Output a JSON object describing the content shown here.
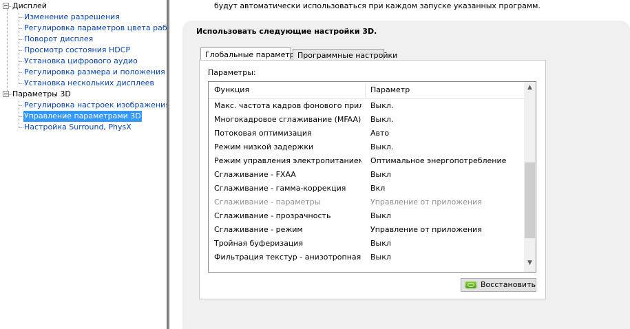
{
  "tree": {
    "display": {
      "label": "Дисплей",
      "items": [
        "Изменение разрешения",
        "Регулировка параметров цвета рабочег",
        "Поворот дисплея",
        "Просмотр состояния HDCP",
        "Установка цифрового аудио",
        "Регулировка размера и положения рабо",
        "Установка нескольких дисплеев"
      ]
    },
    "params3d": {
      "label": "Параметры 3D",
      "items": [
        "Регулировка настроек изображения с пр",
        "Управление параметрами 3D",
        "Настройка Surround, PhysX"
      ]
    }
  },
  "content": {
    "description_tail": "будут автоматически использоваться при каждом запуске указанных программ.",
    "section_title": "Использовать следующие настройки 3D.",
    "tabs": [
      "Глобальные параметры",
      "Программные настройки"
    ],
    "params_label": "Параметры:",
    "table": {
      "columns": [
        "Функция",
        "Параметр"
      ],
      "rows": [
        {
          "feature": "Макс. частота кадров фонового прило...",
          "value": "Выкл."
        },
        {
          "feature": "Многокадровое сглаживание (MFAA)",
          "value": "Выкл."
        },
        {
          "feature": "Потоковая оптимизация",
          "value": "Авто"
        },
        {
          "feature": "Режим низкой задержки",
          "value": "Выкл."
        },
        {
          "feature": "Режим управления электропитанием",
          "value": "Оптимальное энергопотребление"
        },
        {
          "feature": "Сглаживание - FXAA",
          "value": "Выкл"
        },
        {
          "feature": "Сглаживание - гамма-коррекция",
          "value": "Вкл"
        },
        {
          "feature": "Сглаживание - параметры",
          "value": "Управление от приложения"
        },
        {
          "feature": "Сглаживание - прозрачность",
          "value": "Выкл"
        },
        {
          "feature": "Сглаживание - режим",
          "value": "Управление от приложения"
        },
        {
          "feature": "Тройная буферизация",
          "value": "Выкл"
        },
        {
          "feature": "Фильтрация текстур - анизотропная оп...",
          "value": "Выкл"
        }
      ]
    },
    "restore_button": "Восстановить",
    "icons": {
      "scroll_up": "▲",
      "scroll_down": "▼"
    }
  }
}
